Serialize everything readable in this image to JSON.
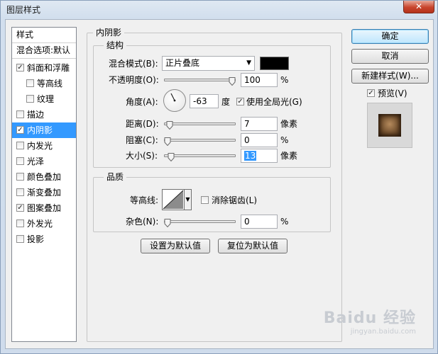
{
  "window": {
    "title": "图层样式",
    "close_glyph": "✕"
  },
  "sidebar": {
    "header": "样式",
    "blend_options": "混合选项:默认",
    "items": [
      {
        "label": "斜面和浮雕",
        "checked": true,
        "sub": false,
        "selected": false
      },
      {
        "label": "等高线",
        "checked": false,
        "sub": true,
        "selected": false
      },
      {
        "label": "纹理",
        "checked": false,
        "sub": true,
        "selected": false
      },
      {
        "label": "描边",
        "checked": false,
        "sub": false,
        "selected": false
      },
      {
        "label": "内阴影",
        "checked": true,
        "sub": false,
        "selected": true
      },
      {
        "label": "内发光",
        "checked": false,
        "sub": false,
        "selected": false
      },
      {
        "label": "光泽",
        "checked": false,
        "sub": false,
        "selected": false
      },
      {
        "label": "颜色叠加",
        "checked": false,
        "sub": false,
        "selected": false
      },
      {
        "label": "渐变叠加",
        "checked": false,
        "sub": false,
        "selected": false
      },
      {
        "label": "图案叠加",
        "checked": true,
        "sub": false,
        "selected": false
      },
      {
        "label": "外发光",
        "checked": false,
        "sub": false,
        "selected": false
      },
      {
        "label": "投影",
        "checked": false,
        "sub": false,
        "selected": false
      }
    ]
  },
  "inner_shadow": {
    "title": "内阴影",
    "structure": {
      "title": "结构",
      "blend_mode_label": "混合模式(B):",
      "blend_mode_value": "正片叠底",
      "blend_color": "#000000",
      "opacity_label": "不透明度(O):",
      "opacity_value": "100",
      "opacity_unit": "%",
      "opacity_level": 1.0,
      "angle_label": "角度(A):",
      "angle_value": "-63",
      "angle_unit": "度",
      "use_global_light_label": "使用全局光(G)",
      "use_global_light": true,
      "distance_label": "距离(D):",
      "distance_value": "7",
      "distance_unit": "像素",
      "distance_level": 0.03,
      "choke_label": "阻塞(C):",
      "choke_value": "0",
      "choke_unit": "%",
      "choke_level": 0.0,
      "size_label": "大小(S):",
      "size_value": "13",
      "size_unit": "像素",
      "size_level": 0.06
    },
    "quality": {
      "title": "品质",
      "contour_label": "等高线:",
      "antialias_label": "消除锯齿(L)",
      "antialias": false,
      "noise_label": "杂色(N):",
      "noise_value": "0",
      "noise_unit": "%",
      "noise_level": 0.0
    },
    "make_default_label": "设置为默认值",
    "reset_default_label": "复位为默认值"
  },
  "actions": {
    "ok_label": "确定",
    "cancel_label": "取消",
    "new_style_label": "新建样式(W)...",
    "preview_label": "预览(V)",
    "preview_checked": true
  },
  "watermark": {
    "text": "Baidu 经验",
    "sub": "jingyan.baidu.com"
  },
  "icons": {
    "close": "close-icon",
    "dropdown": "chevron-down-icon",
    "angle": "angle-dial-icon",
    "contour": "contour-curve-icon",
    "checkbox": "checkmark-icon",
    "slider": "slider-thumb-icon"
  }
}
